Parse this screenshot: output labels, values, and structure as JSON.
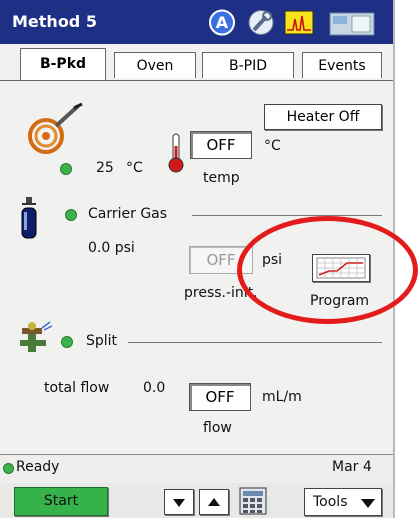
{
  "window": {
    "title": "Method 5"
  },
  "toolbar": {
    "icons": [
      "a-icon",
      "wrench-icon",
      "chromatogram-icon",
      "instrument-icon"
    ]
  },
  "tabs": [
    {
      "label": "B-Pkd",
      "active": true
    },
    {
      "label": "Oven",
      "active": false
    },
    {
      "label": "B-PID",
      "active": false
    },
    {
      "label": "Events",
      "active": false
    }
  ],
  "heater": {
    "button_label": "Heater Off",
    "actual_value": "25",
    "actual_unit": "°C",
    "setpoint": "OFF",
    "setpoint_unit": "°C",
    "setpoint_caption": "temp"
  },
  "carrier": {
    "label": "Carrier Gas",
    "actual_value": "0.0 psi",
    "setpoint": "OFF",
    "setpoint_unit": "psi",
    "setpoint_caption": "press.-init.",
    "program_label": "Program"
  },
  "split": {
    "label": "Split",
    "flow_label": "total flow",
    "flow_value": "0.0",
    "setpoint": "OFF",
    "setpoint_unit": "mL/m",
    "setpoint_caption": "flow"
  },
  "status": {
    "text": "Ready",
    "date": "Mar 4"
  },
  "bottom": {
    "start_label": "Start",
    "tools_label": "Tools"
  },
  "colors": {
    "title_bar": "#1e2f86",
    "status_green": "#3bb34a",
    "highlight_red": "#e41b1b",
    "start_button": "#36b24a"
  }
}
